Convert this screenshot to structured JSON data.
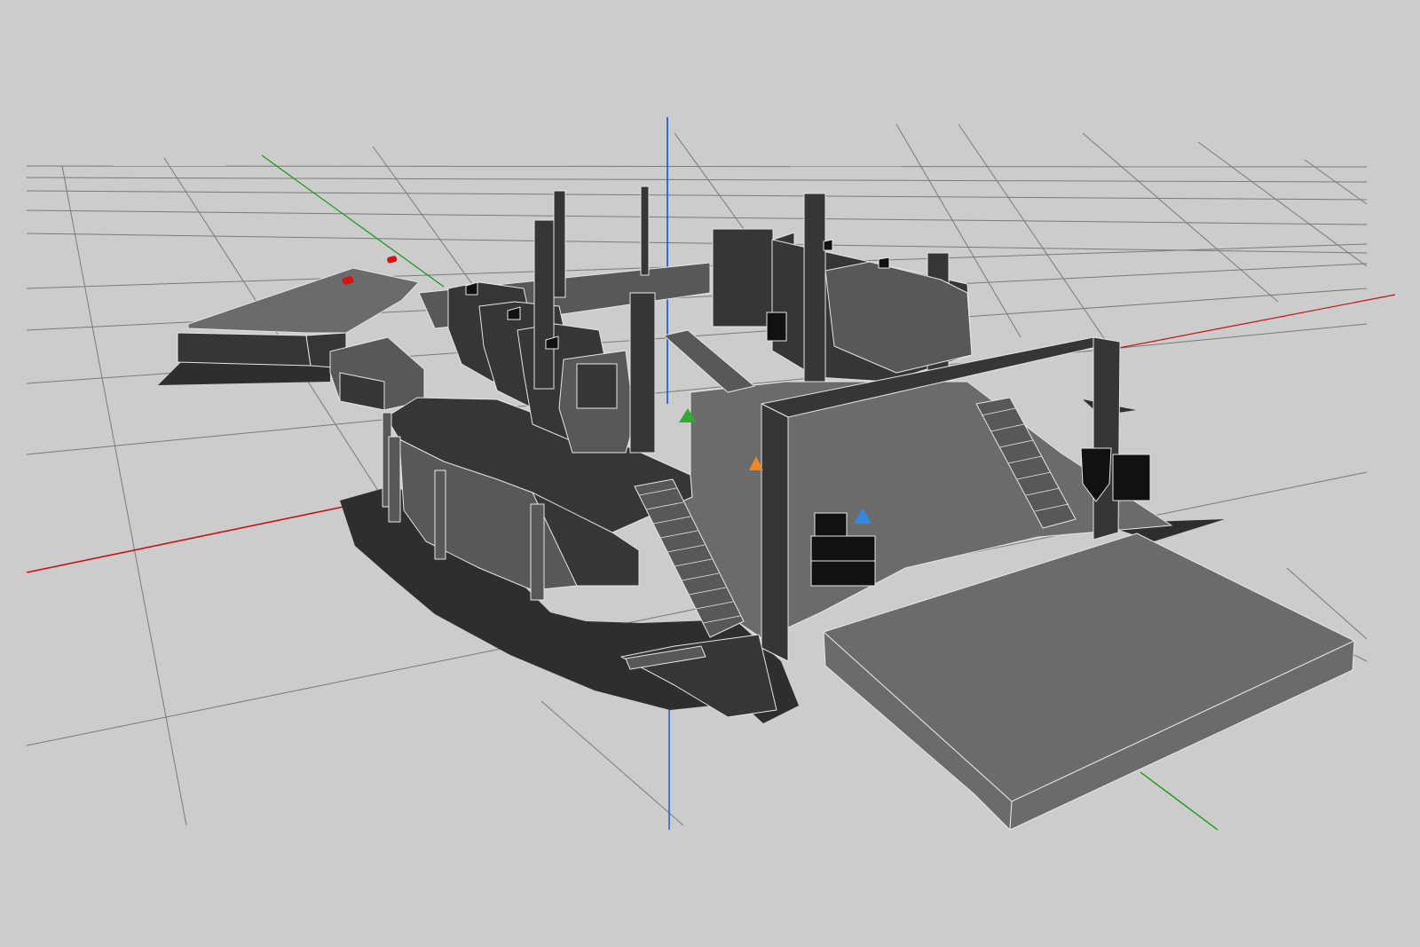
{
  "viewport": {
    "background_color": "#cccccc",
    "grid_color": "#7a7a7a",
    "axis_colors": {
      "x": "#cc1111",
      "y": "#119911",
      "z": "#1155dd"
    }
  },
  "model": {
    "shadow_color": "#2e2e2e",
    "dark_face_color": "#363636",
    "mid_face_color": "#585858",
    "light_face_color": "#6b6b6b",
    "edge_color": "#e6e6e6"
  },
  "markers": [
    {
      "icon": "green-pyramid-icon",
      "color": "#33aa33"
    },
    {
      "icon": "orange-pyramid-icon",
      "color": "#ee8822"
    },
    {
      "icon": "blue-pyramid-icon",
      "color": "#3388dd"
    },
    {
      "icon": "red-capsule-icon",
      "color": "#dd1111"
    }
  ],
  "props": [
    {
      "icon": "speaker-icon"
    },
    {
      "icon": "crate-icon"
    },
    {
      "icon": "shield-icon"
    }
  ]
}
